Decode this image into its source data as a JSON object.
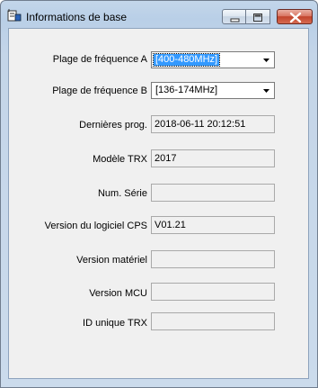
{
  "window": {
    "title": "Informations de base",
    "app_icon": "radio-app-icon",
    "buttons": [
      "minimize-icon",
      "maximize-icon",
      "close-icon"
    ]
  },
  "fields": {
    "band_a": {
      "label": "Plage de fréquence A",
      "value": "[400-480MHz]"
    },
    "band_b": {
      "label": "Plage de fréquence B",
      "value": "[136-174MHz]"
    },
    "last_prog": {
      "label": "Dernières prog.",
      "value": "2018-06-11 20:12:51"
    },
    "model": {
      "label": "Modèle TRX",
      "value": "2017"
    },
    "serial": {
      "label": "Num. Série",
      "value": ""
    },
    "cps_version": {
      "label": "Version du logiciel CPS",
      "value": "V01.21"
    },
    "hw_version": {
      "label": "Version matériel",
      "value": ""
    },
    "mcu_version": {
      "label": "Version MCU",
      "value": ""
    },
    "trx_id": {
      "label": "ID unique TRX",
      "value": ""
    }
  },
  "colors": {
    "selection": "#3399ff",
    "close_button": "#c2442c",
    "frame": "#b9cfe7"
  }
}
